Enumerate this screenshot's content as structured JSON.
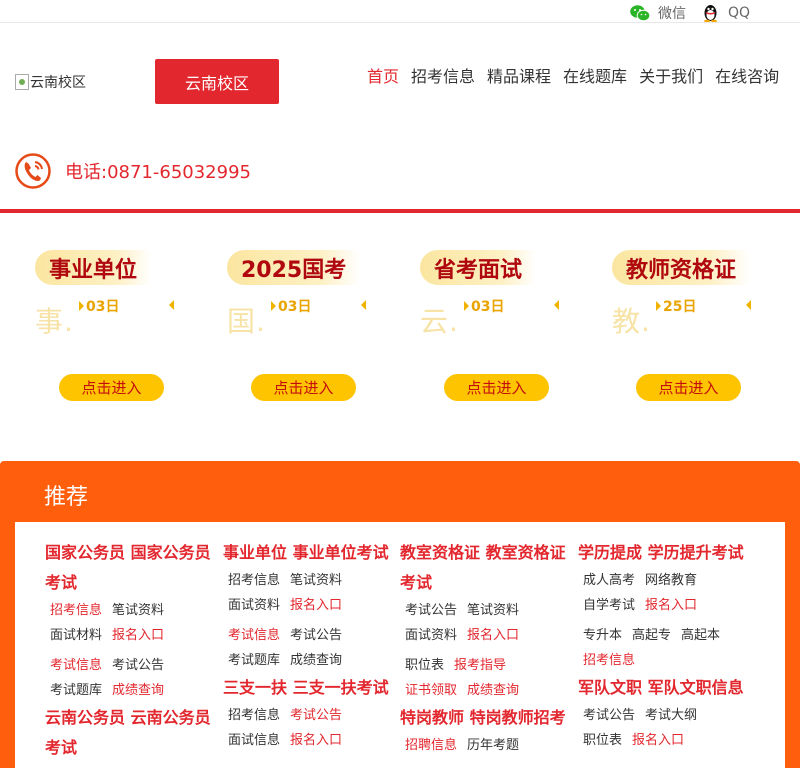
{
  "topbar": {
    "wechat": "微信",
    "qq": "QQ"
  },
  "header": {
    "logo_alt": "云南校区",
    "campus_button": "云南校区",
    "nav": [
      {
        "label": "首页",
        "active": true
      },
      {
        "label": "招考信息",
        "active": false
      },
      {
        "label": "精品课程",
        "active": false
      },
      {
        "label": "在线题库",
        "active": false
      },
      {
        "label": "关于我们",
        "active": false
      },
      {
        "label": "在线咨询",
        "active": false
      }
    ],
    "phone": "电话:0871-65032995"
  },
  "cards": [
    {
      "title": "事业单位",
      "ghost": "事.",
      "days": "03日",
      "button": "点击进入"
    },
    {
      "title": "2025国考",
      "ghost": "国.",
      "days": "03日",
      "button": "点击进入"
    },
    {
      "title": "省考面试",
      "ghost": "云.",
      "days": "03日",
      "button": "点击进入"
    },
    {
      "title": "教师资格证",
      "ghost": "教.",
      "days": "25日",
      "button": "点击进入"
    }
  ],
  "recommend": {
    "title": "推荐",
    "columns": [
      {
        "groups": [
          {
            "title": "国家公务员 国家公务员考试",
            "rows": [
              [
                {
                  "t": "招考信息",
                  "hot": true
                },
                {
                  "t": "笔试资料",
                  "hot": false
                }
              ],
              [
                {
                  "t": "面试材料",
                  "hot": false
                },
                {
                  "t": "报名入口",
                  "hot": true
                }
              ]
            ]
          },
          {
            "title": "",
            "rows": [
              [
                {
                  "t": "考试信息",
                  "hot": true
                },
                {
                  "t": "考试公告",
                  "hot": false
                }
              ],
              [
                {
                  "t": "考试题库",
                  "hot": false
                },
                {
                  "t": "成绩查询",
                  "hot": true
                }
              ]
            ]
          },
          {
            "title": "云南公务员 云南公务员考试",
            "rows": []
          }
        ]
      },
      {
        "groups": [
          {
            "title": "事业单位 事业单位考试",
            "rows": [
              [
                {
                  "t": "招考信息",
                  "hot": false
                },
                {
                  "t": "笔试资料",
                  "hot": false
                }
              ],
              [
                {
                  "t": "面试资料",
                  "hot": false
                },
                {
                  "t": "报名入口",
                  "hot": true
                }
              ]
            ]
          },
          {
            "title": "",
            "rows": [
              [
                {
                  "t": "考试信息",
                  "hot": true
                },
                {
                  "t": "考试公告",
                  "hot": false
                }
              ],
              [
                {
                  "t": "考试题库",
                  "hot": false
                },
                {
                  "t": "成绩查询",
                  "hot": false
                }
              ]
            ]
          },
          {
            "title": "三支一扶 三支一扶考试",
            "rows": [
              [
                {
                  "t": "招考信息",
                  "hot": false
                },
                {
                  "t": "考试公告",
                  "hot": true
                }
              ],
              [
                {
                  "t": "面试信息",
                  "hot": false
                },
                {
                  "t": "报名入口",
                  "hot": true
                }
              ]
            ]
          }
        ]
      },
      {
        "groups": [
          {
            "title": "教室资格证 教室资格证考试",
            "rows": [
              [
                {
                  "t": "考试公告",
                  "hot": false
                },
                {
                  "t": "笔试资料",
                  "hot": false
                }
              ],
              [
                {
                  "t": "面试资料",
                  "hot": false
                },
                {
                  "t": "报名入口",
                  "hot": true
                }
              ]
            ]
          },
          {
            "title": "",
            "rows": [
              [
                {
                  "t": "职位表",
                  "hot": false
                },
                {
                  "t": "报考指导",
                  "hot": true
                }
              ],
              [
                {
                  "t": "证书领取",
                  "hot": true
                },
                {
                  "t": "成绩查询",
                  "hot": true
                }
              ]
            ]
          },
          {
            "title": "特岗教师 特岗教师招考",
            "rows": [
              [
                {
                  "t": "招聘信息",
                  "hot": true
                },
                {
                  "t": "历年考题",
                  "hot": false
                }
              ]
            ]
          }
        ]
      },
      {
        "groups": [
          {
            "title": "学历提成 学历提升考试",
            "rows": [
              [
                {
                  "t": "成人高考",
                  "hot": false
                },
                {
                  "t": "网络教育",
                  "hot": false
                }
              ],
              [
                {
                  "t": "自学考试",
                  "hot": false
                },
                {
                  "t": "报名入口",
                  "hot": true
                }
              ]
            ]
          },
          {
            "title": "",
            "rows": [
              [
                {
                  "t": "专升本",
                  "hot": false
                },
                {
                  "t": "高起专",
                  "hot": false
                },
                {
                  "t": "高起本",
                  "hot": false
                }
              ],
              [
                {
                  "t": "招考信息",
                  "hot": true
                }
              ]
            ]
          },
          {
            "title": "军队文职 军队文职信息",
            "rows": [
              [
                {
                  "t": "考试公告",
                  "hot": false
                },
                {
                  "t": "考试大纲",
                  "hot": false
                }
              ],
              [
                {
                  "t": "职位表",
                  "hot": false
                },
                {
                  "t": "报名入口",
                  "hot": true
                }
              ]
            ]
          }
        ]
      }
    ]
  },
  "colors": {
    "brand_red": "#e3272e",
    "orange": "#ff5e0c",
    "yellow": "#fec400"
  }
}
